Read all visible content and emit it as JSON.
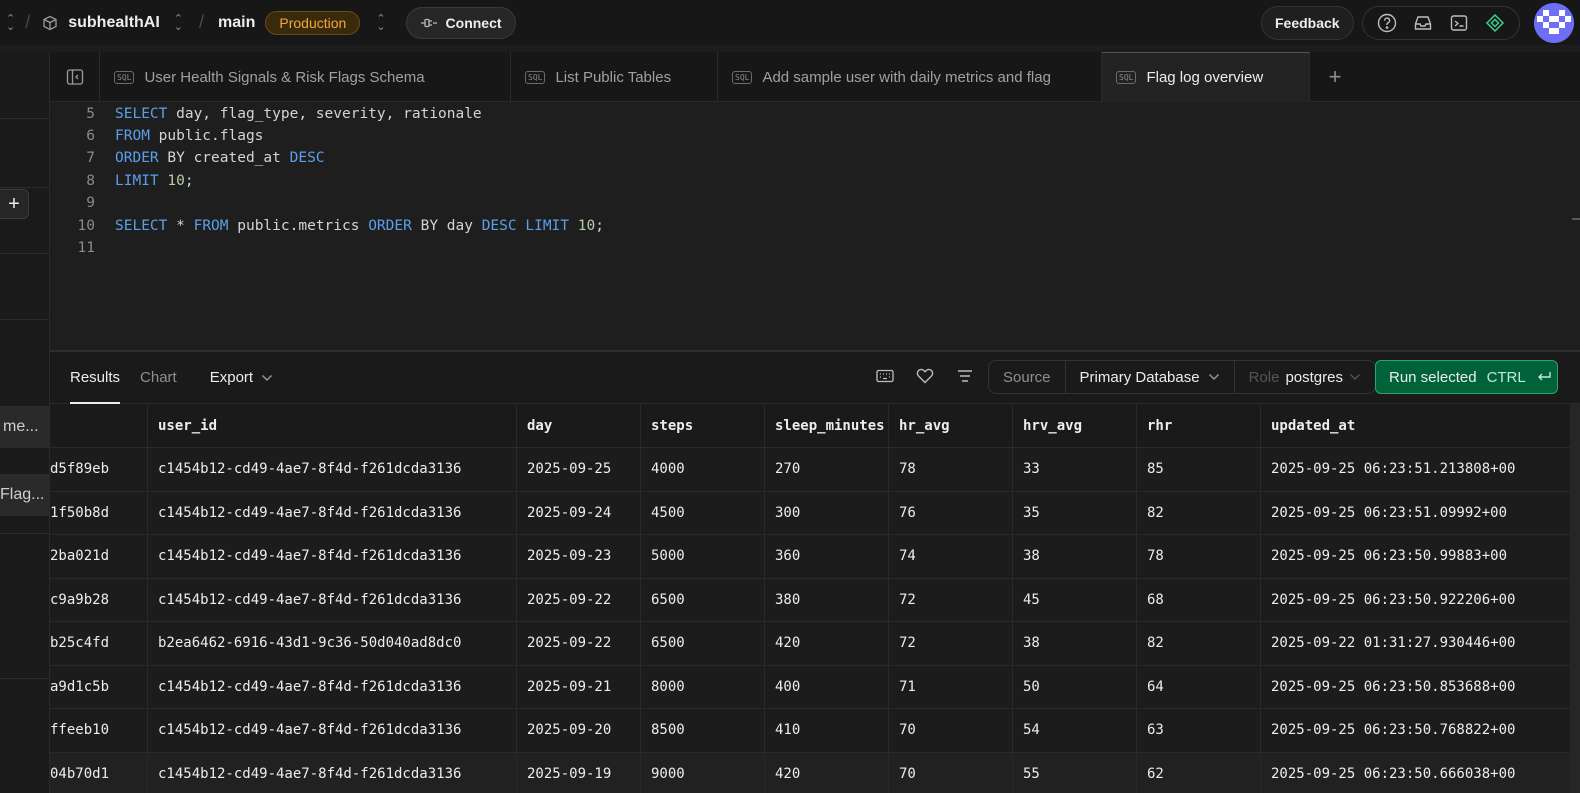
{
  "topbar": {
    "project_name": "subhealthAI",
    "branch_name": "main",
    "env_badge": "Production",
    "connect_label": "Connect",
    "feedback_label": "Feedback",
    "icons": [
      "help-icon",
      "inbox-icon",
      "terminal-icon",
      "ai-assistant-icon"
    ]
  },
  "sidebar": {
    "items": [
      {
        "label": "me..."
      },
      {
        "label": "Flag..."
      }
    ]
  },
  "tabs": [
    {
      "label": "User Health Signals & Risk Flags Schema",
      "active": false
    },
    {
      "label": "List Public Tables",
      "active": false
    },
    {
      "label": "Add sample user with daily metrics and flag",
      "active": false
    },
    {
      "label": "Flag log overview",
      "active": true
    }
  ],
  "editor": {
    "lines": [
      {
        "n": "5",
        "text": "SELECT day, flag_type, severity, rationale"
      },
      {
        "n": "6",
        "text": "FROM public.flags"
      },
      {
        "n": "7",
        "text": "ORDER BY created_at DESC"
      },
      {
        "n": "8",
        "text": "LIMIT 10;"
      },
      {
        "n": "9",
        "text": ""
      },
      {
        "n": "10",
        "text": "SELECT * FROM public.metrics ORDER BY day DESC LIMIT 10;"
      },
      {
        "n": "11",
        "text": ""
      }
    ]
  },
  "results": {
    "tab_results": "Results",
    "tab_chart": "Chart",
    "export_label": "Export",
    "source_label": "Source",
    "source_value": "Primary Database",
    "role_label": "Role",
    "role_value": "postgres",
    "run_label": "Run selected",
    "run_shortcut": "CTRL"
  },
  "table": {
    "columns": [
      "",
      "user_id",
      "day",
      "steps",
      "sleep_minutes",
      "hr_avg",
      "hrv_avg",
      "rhr",
      "updated_at"
    ],
    "rows": [
      [
        "d5f89eb",
        "c1454b12-cd49-4ae7-8f4d-f261dcda3136",
        "2025-09-25",
        "4000",
        "270",
        "78",
        "33",
        "85",
        "2025-09-25 06:23:51.213808+00"
      ],
      [
        "1f50b8d",
        "c1454b12-cd49-4ae7-8f4d-f261dcda3136",
        "2025-09-24",
        "4500",
        "300",
        "76",
        "35",
        "82",
        "2025-09-25 06:23:51.09992+00"
      ],
      [
        "2ba021d",
        "c1454b12-cd49-4ae7-8f4d-f261dcda3136",
        "2025-09-23",
        "5000",
        "360",
        "74",
        "38",
        "78",
        "2025-09-25 06:23:50.99883+00"
      ],
      [
        "c9a9b28",
        "c1454b12-cd49-4ae7-8f4d-f261dcda3136",
        "2025-09-22",
        "6500",
        "380",
        "72",
        "45",
        "68",
        "2025-09-25 06:23:50.922206+00"
      ],
      [
        "b25c4fd",
        "b2ea6462-6916-43d1-9c36-50d040ad8dc0",
        "2025-09-22",
        "6500",
        "420",
        "72",
        "38",
        "82",
        "2025-09-22 01:31:27.930446+00"
      ],
      [
        "a9d1c5b",
        "c1454b12-cd49-4ae7-8f4d-f261dcda3136",
        "2025-09-21",
        "8000",
        "400",
        "71",
        "50",
        "64",
        "2025-09-25 06:23:50.853688+00"
      ],
      [
        "ffeeb10",
        "c1454b12-cd49-4ae7-8f4d-f261dcda3136",
        "2025-09-20",
        "8500",
        "410",
        "70",
        "54",
        "63",
        "2025-09-25 06:23:50.768822+00"
      ],
      [
        "04b70d1",
        "c1454b12-cd49-4ae7-8f4d-f261dcda3136",
        "2025-09-19",
        "9000",
        "420",
        "70",
        "55",
        "62",
        "2025-09-25 06:23:50.666038+00"
      ]
    ]
  },
  "colors": {
    "accent_run": "#006239",
    "badge_text": "#f2a83b",
    "keyword": "#5aa0e8"
  }
}
